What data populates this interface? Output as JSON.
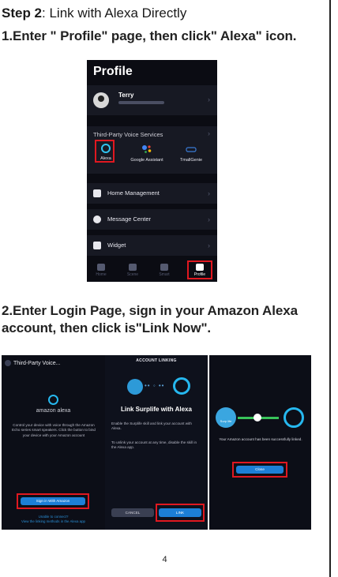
{
  "heading": {
    "step_label": "Step 2",
    "step_text": ": Link with Alexa Directly"
  },
  "instruction1": "1.Enter \" Profile\" page, then click\" Alexa\" icon.",
  "instruction2": "2.Enter Login Page, sign in your Amazon Alexa account, then click is\"Link Now\".",
  "profile_screen": {
    "title": "Profile",
    "user_name": "Terry",
    "voice_services_title": "Third-Party Voice Services",
    "services": [
      "Alexa",
      "Google Assistant",
      "TmallGenie"
    ],
    "menu": [
      "Home Management",
      "Message Center",
      "Widget"
    ],
    "nav": [
      "Home",
      "Scene",
      "Smart",
      "Profile"
    ],
    "highlight_color": "#e01820"
  },
  "screen1": {
    "header": "Third-Party Voice...",
    "brand": "amazon alexa",
    "description": "Control your device with voice through the Amazon Echo series smart speakers. Click the button to bind your device with your Amazon account",
    "sign_in_button": "Sign in With Amazon",
    "help_link1": "Unable to connect?",
    "help_link2": "View the linking methods in the Alexa app"
  },
  "screen2": {
    "header": "ACCOUNT LINKING",
    "title": "Link Surplife with Alexa",
    "para1": "Enable the Surplife skill and link your account with Alexa.",
    "para2": "To unlink your account at any time, disable the skill in the Alexa app.",
    "cancel_button": "CANCEL",
    "link_button": "LINK"
  },
  "screen3": {
    "badge_text": "Surp life",
    "message": "Your Amazon account has been successfully linked.",
    "close_button": "Close"
  },
  "page_number": "4",
  "colors": {
    "alexa_blue": "#26b8ef",
    "button_blue": "#1c7fd6",
    "highlight_red": "#e01820"
  }
}
